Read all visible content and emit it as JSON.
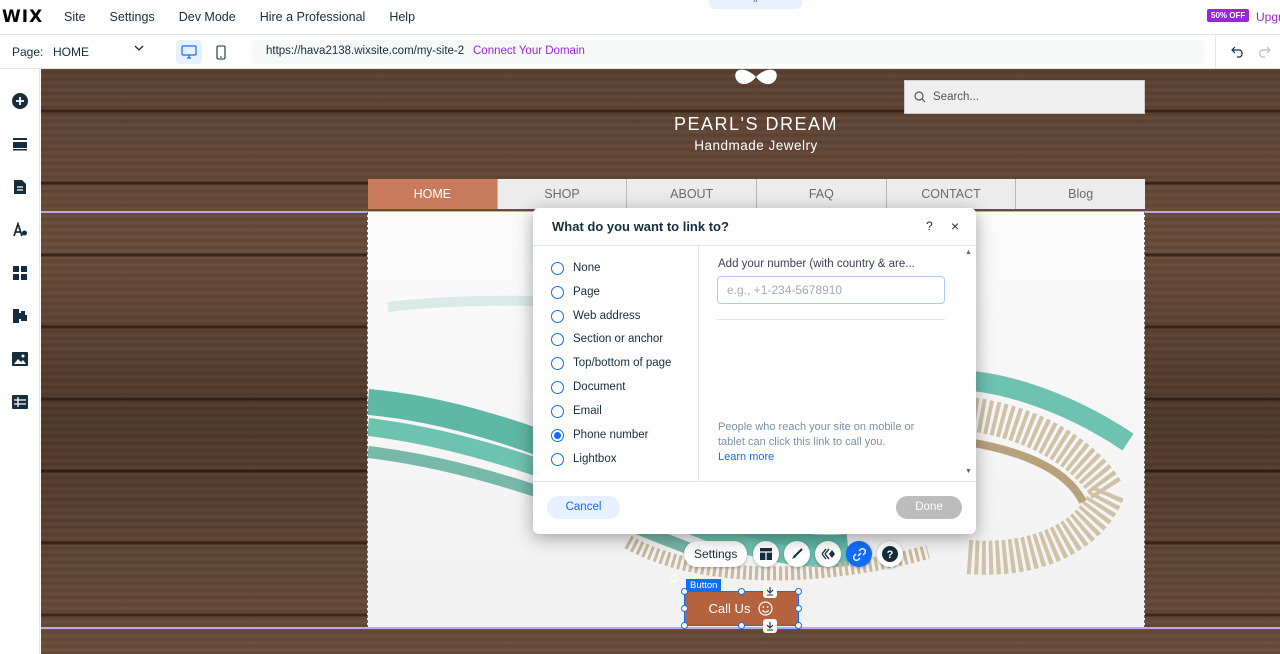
{
  "topbar": {
    "logo": "WIX",
    "menu": [
      "Site",
      "Settings",
      "Dev Mode",
      "Hire a Professional",
      "Help"
    ],
    "promo_badge": "50% OFF",
    "upgrade": "Upgr",
    "collapse_glyph": "^"
  },
  "urlbar": {
    "page_label": "Page:",
    "page_value": "HOME",
    "url": "https://hava2138.wixsite.com/my-site-2",
    "connect": "Connect Your Domain"
  },
  "site": {
    "title": "PEARL'S DREAM",
    "subtitle": "Handmade Jewelry",
    "search_placeholder": "Search...",
    "nav": [
      "HOME",
      "SHOP",
      "ABOUT",
      "FAQ",
      "CONTACT",
      "Blog"
    ],
    "nav_active": "HOME"
  },
  "toolbar": {
    "settings_label": "Settings",
    "tag": "Button",
    "button_label": "Call Us"
  },
  "modal": {
    "title": "What do you want to link to?",
    "help": "?",
    "close": "×",
    "options": [
      "None",
      "Page",
      "Web address",
      "Section or anchor",
      "Top/bottom of page",
      "Document",
      "Email",
      "Phone number",
      "Lightbox"
    ],
    "selected": "Phone number",
    "phone_label": "Add your number (with country & are...",
    "phone_placeholder": "e.g., +1-234-5678910",
    "hint": "People who reach your site on mobile or tablet can click this link to call you.",
    "learn_more": "Learn more",
    "cancel": "Cancel",
    "done": "Done"
  },
  "colors": {
    "accent": "#116dff",
    "brand_purple": "#9a27d5",
    "nav_active": "#c87a5a",
    "call_button": "#b5633e"
  }
}
